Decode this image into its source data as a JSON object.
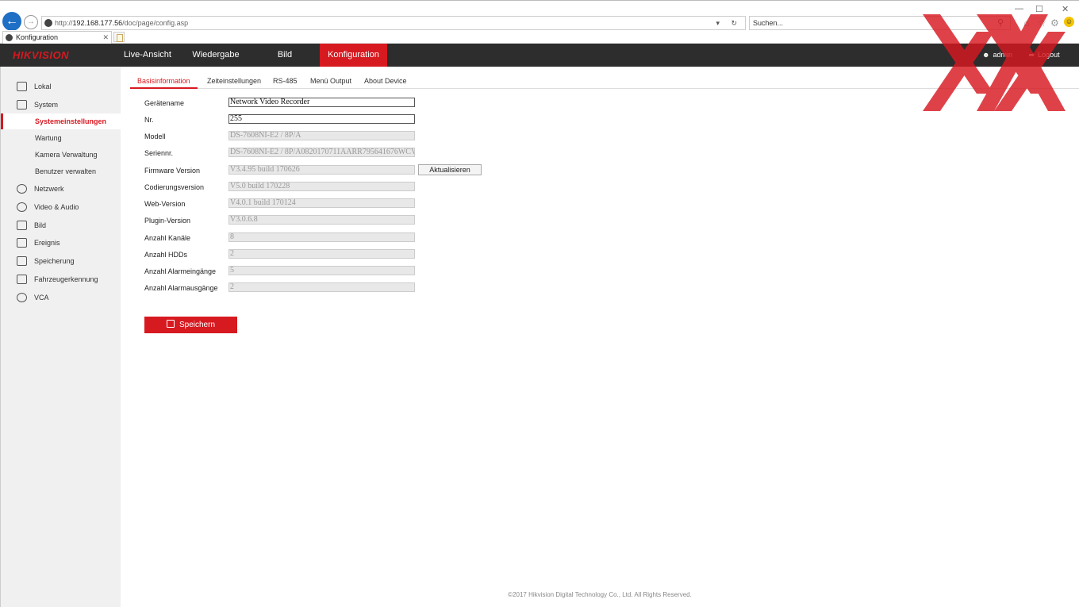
{
  "browser": {
    "url_prefix": "http://",
    "url_host": "192.168.177.56",
    "url_path": "/doc/page/config.asp",
    "search_placeholder": "Suchen...",
    "tab_title": "Konfiguration",
    "window_controls": [
      "—",
      "☐",
      "✕"
    ]
  },
  "header": {
    "logo": "HIKVISION",
    "nav": [
      {
        "label": "Live-Ansicht"
      },
      {
        "label": "Wiedergabe"
      },
      {
        "label": "Bild"
      },
      {
        "label": "Konfiguration",
        "active": true
      }
    ],
    "user": "admin",
    "logout": "Logout",
    "brand_color": "#d71920"
  },
  "sidebar": {
    "items": [
      {
        "label": "Lokal",
        "icon": "monitor-icon"
      },
      {
        "label": "System",
        "icon": "system-icon"
      },
      {
        "label": "Systemeinstellungen",
        "sub": true,
        "active": true
      },
      {
        "label": "Wartung",
        "sub": true
      },
      {
        "label": "Kamera Verwaltung",
        "sub": true
      },
      {
        "label": "Benutzer verwalten",
        "sub": true
      },
      {
        "label": "Netzwerk",
        "icon": "globe-icon"
      },
      {
        "label": "Video & Audio",
        "icon": "video-audio-icon"
      },
      {
        "label": "Bild",
        "icon": "image-icon"
      },
      {
        "label": "Ereignis",
        "icon": "calendar-icon"
      },
      {
        "label": "Speicherung",
        "icon": "storage-icon"
      },
      {
        "label": "Fahrzeugerkennung",
        "icon": "vehicle-search-icon"
      },
      {
        "label": "VCA",
        "icon": "vca-icon"
      }
    ]
  },
  "subtabs": [
    {
      "label": "Basisinformation",
      "active": true
    },
    {
      "label": "Zeiteinstellungen"
    },
    {
      "label": "RS-485"
    },
    {
      "label": "Menü Output"
    },
    {
      "label": "About Device"
    }
  ],
  "form": {
    "fields": [
      {
        "label": "Gerätename",
        "value": "Network Video Recorder",
        "editable": true
      },
      {
        "label": "Nr.",
        "value": "255",
        "editable": true
      },
      {
        "label": "Modell",
        "value": "DS-7608NI-E2 / 8P/A"
      },
      {
        "label": "Seriennr.",
        "value": "DS-7608NI-E2 / 8P/A0820170711AARR795641676WCVU"
      },
      {
        "label": "Firmware Version",
        "value": "V3.4.95 build 170626"
      },
      {
        "label": "Codierungsversion",
        "value": "V5.0 build 170228"
      },
      {
        "label": "Web-Version",
        "value": "V4.0.1 build 170124"
      },
      {
        "label": "Plugin-Version",
        "value": "V3.0.6.8"
      },
      {
        "label": "Anzahl Kanäle",
        "value": "8"
      },
      {
        "label": "Anzahl HDDs",
        "value": "2"
      },
      {
        "label": "Anzahl Alarmeingänge",
        "value": "5"
      },
      {
        "label": "Anzahl Alarmausgänge",
        "value": "2"
      }
    ],
    "update_button": "Aktualisieren",
    "save_button": "Speichern"
  },
  "footer": "©2017 Hikvision Digital Technology Co., Ltd. All Rights Reserved."
}
